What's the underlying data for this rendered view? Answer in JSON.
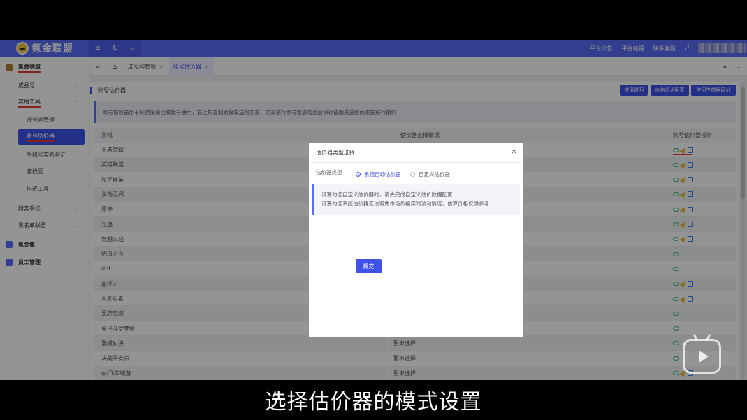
{
  "topbar": {
    "logo": "氪金联盟",
    "icons": [
      "menu-icon",
      "refresh-icon",
      "search-icon"
    ],
    "right_links": [
      "平台公告",
      "平台帕福",
      "联系客服"
    ],
    "fullscreen_icon": "fullscreen-icon"
  },
  "sidebar": {
    "items": [
      {
        "label": "氪金联盟",
        "level": "top",
        "icon": "flame-icon",
        "color": "#b07c3a",
        "underline": true
      },
      {
        "label": "成品号",
        "level": "sub",
        "expand": "down"
      },
      {
        "label": "实用工具",
        "level": "sub",
        "expand": "up",
        "underline": true
      },
      {
        "label": "洗号网管理",
        "level": "leaf"
      },
      {
        "label": "账号估价器",
        "level": "leaf",
        "active": true,
        "underline": true
      },
      {
        "label": "手机号实名验证",
        "level": "leaf"
      },
      {
        "label": "查找回",
        "level": "leaf"
      },
      {
        "label": "抖逐工具",
        "level": "leaf"
      },
      {
        "label": "财务系统",
        "level": "sub",
        "expand": "down"
      },
      {
        "label": "黑名单联盟",
        "level": "sub",
        "expand": "down"
      },
      {
        "label": "氪金集",
        "level": "top",
        "icon": "shop-icon",
        "color": "#5b6cf5"
      },
      {
        "label": "员工管理",
        "level": "top",
        "icon": "user-icon",
        "color": "#5b6cf5"
      }
    ]
  },
  "tabbar": {
    "tabs": [
      {
        "label": "选号网管理",
        "active": false
      },
      {
        "label": "账号估价器",
        "active": true
      }
    ],
    "close": "×",
    "prev": "«",
    "next": "»"
  },
  "panel": {
    "title": "账号估价器",
    "buttons": [
      "使用说明",
      "价格话术配置",
      "使用生成器网址"
    ],
    "notice": "账号估价器用于其他渠道回收账号使用，右上角复制链接发送给卖家，卖家进行账号信息勾选后保存截图发送给商家据进行报价",
    "columns": [
      "游戏",
      "估价器选择情况",
      "账号估价器操作"
    ],
    "rows": [
      {
        "game": "王者荣耀",
        "status": "",
        "ops": "full"
      },
      {
        "game": "英雄联盟",
        "status": "",
        "ops": "full"
      },
      {
        "game": "和平精英",
        "status": "",
        "ops": "full"
      },
      {
        "game": "永劫无间",
        "status": "",
        "ops": "full"
      },
      {
        "game": "原神",
        "status": "",
        "ops": "full"
      },
      {
        "game": "光遇",
        "status": "",
        "ops": "full"
      },
      {
        "game": "穿越火线",
        "status": "",
        "ops": "full"
      },
      {
        "game": "明日方舟",
        "status": "",
        "ops": "view"
      },
      {
        "game": "dnf",
        "status": "",
        "ops": "view"
      },
      {
        "game": "崩坏3",
        "status": "",
        "ops": "full"
      },
      {
        "game": "火影忍者",
        "status": "",
        "ops": "full"
      },
      {
        "game": "王牌竞速",
        "status": "",
        "ops": "view"
      },
      {
        "game": "蛋仔斗罗梦境",
        "status": "",
        "ops": "view"
      },
      {
        "game": "漫威对决",
        "status": "暂未选择",
        "ops": "view"
      },
      {
        "game": "决战平安京",
        "status": "暂未选择",
        "ops": "view"
      },
      {
        "game": "qq飞车端游",
        "status": "暂未选择",
        "ops": "full"
      }
    ]
  },
  "dialog": {
    "title": "估价器类型选择",
    "close": "×",
    "field_label": "估价器类型",
    "options": [
      {
        "label": "系统自动估价器",
        "selected": true
      },
      {
        "label": "自定义估价器",
        "selected": false
      }
    ],
    "note_lines": [
      "设置勾选自定义估价器时，请先完成自定义估价数据配置",
      "设置勾选系统估价器无法避免市场价格实时波动情况，估算价格仅供参考"
    ],
    "submit": "提交"
  },
  "caption": "选择估价器的模式设置",
  "colors": {
    "brand": "#5b6cf5",
    "active": "#3f51e8",
    "underline": "#e53935",
    "eye": "#2eb872",
    "plane": "#e8b83a",
    "edit": "#3f7cf5"
  }
}
